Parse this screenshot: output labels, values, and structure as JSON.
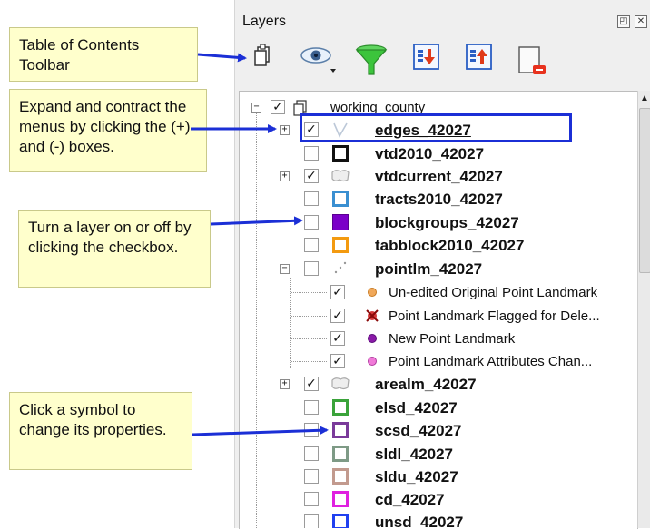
{
  "panel": {
    "title": "Layers",
    "float_button": "◰",
    "close_button": "✕"
  },
  "toolbar": {
    "icons": [
      "add-group-icon",
      "visibility-eye-icon",
      "filter-funnel-icon",
      "expand-all-icon",
      "collapse-all-icon",
      "remove-layer-icon"
    ]
  },
  "tree": {
    "root": {
      "label": "working_county",
      "checked": true,
      "expanded": true
    },
    "layers": [
      {
        "label": "edges_42027",
        "checked": true,
        "expander": "+",
        "symbol": "line",
        "underline": true
      },
      {
        "label": "vtd2010_42027",
        "checked": false,
        "expander": "",
        "symbol": "square",
        "color": "#111111"
      },
      {
        "label": "vtdcurrent_42027",
        "checked": true,
        "expander": "+",
        "symbol": "area"
      },
      {
        "label": "tracts2010_42027",
        "checked": false,
        "expander": "",
        "symbol": "square",
        "color": "#3a8fd1"
      },
      {
        "label": "blockgroups_42027",
        "checked": false,
        "expander": "",
        "symbol": "filled",
        "color": "#7b00c8"
      },
      {
        "label": "tabblock2010_42027",
        "checked": false,
        "expander": "",
        "symbol": "square",
        "color": "#f39a10"
      },
      {
        "label": "pointlm_42027",
        "checked": false,
        "expander": "-",
        "symbol": "points"
      },
      {
        "label": "arealm_42027",
        "checked": true,
        "expander": "+",
        "symbol": "area"
      },
      {
        "label": "elsd_42027",
        "checked": false,
        "expander": "",
        "symbol": "square",
        "color": "#3aa33a"
      },
      {
        "label": "scsd_42027",
        "checked": false,
        "expander": "",
        "symbol": "square",
        "color": "#7a3a9a"
      },
      {
        "label": "sldl_42027",
        "checked": false,
        "expander": "",
        "symbol": "square",
        "color": "#7e9a86"
      },
      {
        "label": "sldu_42027",
        "checked": false,
        "expander": "",
        "symbol": "square",
        "color": "#c29a8e"
      },
      {
        "label": "cd_42027",
        "checked": false,
        "expander": "",
        "symbol": "square",
        "color": "#e020e0"
      },
      {
        "label": "unsd_42027",
        "checked": false,
        "expander": "",
        "symbol": "square",
        "color": "#2040f0"
      }
    ],
    "pointlm_sub": [
      {
        "label": "Un-edited Original Point Landmark",
        "checked": true,
        "dot": "#f0a85a",
        "dot_border": "#c87a20"
      },
      {
        "label": "Point Landmark Flagged for Dele...",
        "checked": true,
        "dot": "#d63a3a",
        "dot_border": "#a01010"
      },
      {
        "label": "New Point Landmark",
        "checked": true,
        "dot": "#8a1aa8",
        "dot_border": "#5a0a78"
      },
      {
        "label": "Point Landmark Attributes Chan...",
        "checked": true,
        "dot": "#f07ad8",
        "dot_border": "#b03aa0"
      }
    ]
  },
  "callouts": {
    "toolbar": "Table of Contents Toolbar",
    "expand": "Expand and contract the menus by clicking the (+) and (-) boxes.",
    "toggle": "Turn a layer on or off by clicking the checkbox.",
    "symbol": "Click a symbol to change its properties."
  },
  "colors": {
    "callout_bg": "#ffffcc",
    "arrow": "#1b2fd6",
    "highlight": "#1b2fd6"
  }
}
